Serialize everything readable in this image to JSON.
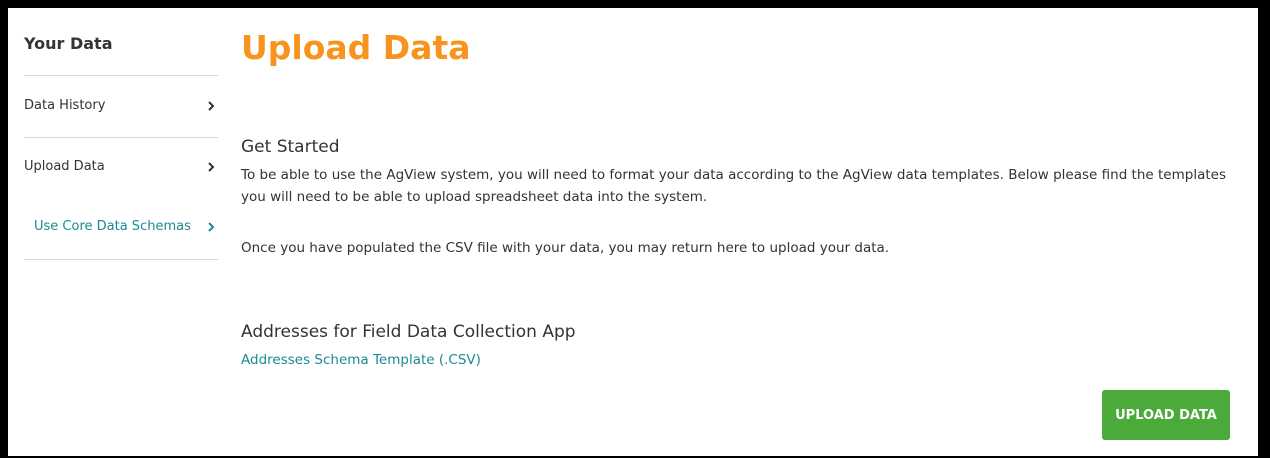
{
  "sidebar": {
    "title": "Your Data",
    "items": [
      {
        "label": "Data History",
        "icon": "chevron-right-icon"
      },
      {
        "label": "Upload Data",
        "icon": "chevron-right-icon"
      },
      {
        "label": "Use Core Data Schemas",
        "icon": "chevron-right-icon"
      }
    ],
    "active_index": 2
  },
  "main": {
    "title": "Upload Data",
    "get_started": {
      "heading": "Get Started",
      "paragraph_1": "To be able to use the AgView system, you will need to format your data according to the AgView data templates. Below please find the templates you will need to be able to upload spreadsheet data into the system.",
      "paragraph_2": "Once you have populated the CSV file with your data, you may return here to upload your data."
    },
    "addresses": {
      "heading": "Addresses for Field Data Collection App",
      "link_label": "Addresses Schema Template (.CSV)"
    },
    "upload_button_label": "UPLOAD DATA"
  },
  "colors": {
    "title_accent": "#f7941d",
    "link": "#1a8a96",
    "button": "#4aaa3a",
    "text": "#333333"
  }
}
